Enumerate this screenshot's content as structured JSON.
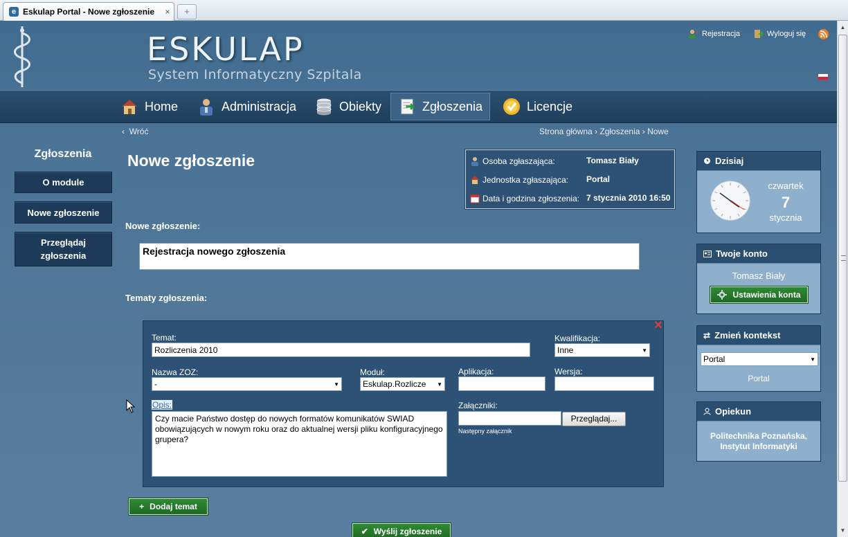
{
  "browser": {
    "tab_title": "Eskulap Portal - Nowe zgłoszenie",
    "tab_close": "×",
    "new_tab": "+"
  },
  "header": {
    "brand_title": "ESKULAP",
    "brand_subtitle": "System Informatyczny Szpitala",
    "register_link": "Rejestracja",
    "logout_link": "Wyloguj się"
  },
  "nav": {
    "items": [
      {
        "label": "Home",
        "icon": "house-icon"
      },
      {
        "label": "Administracja",
        "icon": "user-admin-icon"
      },
      {
        "label": "Obiekty",
        "icon": "database-icon"
      },
      {
        "label": "Zgłoszenia",
        "icon": "document-arrow-icon",
        "active": true
      },
      {
        "label": "Licencje",
        "icon": "certificate-badge-icon"
      }
    ]
  },
  "breadcrumb": {
    "back": "Wróć",
    "back_glyph": "‹",
    "path": "Strona główna › Zgłoszenia › Nowe"
  },
  "sidebar": {
    "title": "Zgłoszenia",
    "buttons": [
      "O module",
      "Nowe zgłoszenie",
      "Przeglądaj zgłoszenia"
    ]
  },
  "page": {
    "title": "Nowe zgłoszenie"
  },
  "info": {
    "reporter_label": "Osoba zgłaszająca:",
    "reporter_value": "Tomasz Biały",
    "unit_label": "Jednostka zgłaszająca:",
    "unit_value": "Portal",
    "datetime_label": "Data i godzina zgłoszenia:",
    "datetime_value": "7 stycznia 2010 16:50"
  },
  "form": {
    "new_ticket_label": "Nowe zgłoszenie:",
    "new_ticket_value": "Rejestracja nowego zgłoszenia",
    "topics_label": "Tematy zgłoszenia:",
    "topic_close": "✕",
    "topic": {
      "subject_label": "Temat:",
      "subject_value": "Rozliczenia 2010",
      "qualification_label": "Kwalifikacja:",
      "qualification_value": "Inne",
      "zoz_label": "Nazwa ZOZ:",
      "zoz_value": "-",
      "module_label": "Moduł:",
      "module_value": "Eskulap.Rozlicze",
      "application_label": "Aplikacja:",
      "application_value": "",
      "version_label": "Wersja:",
      "version_value": "",
      "description_label": "Opis:",
      "description_value": "Czy macie Państwo dostęp do nowych formatów komunikatów SWIAD obowiązujących w nowym roku oraz do aktualnej wersji pliku konfiguracyjnego grupera?",
      "attachments_label": "Załączniki:",
      "attachment_value": "",
      "browse_label": "Przeglądaj...",
      "next_attachment": "Następny załącznik"
    },
    "add_topic_label": "Dodaj temat",
    "add_topic_glyph": "+",
    "submit_label": "Wyślij zgłoszenie",
    "submit_glyph": "✔"
  },
  "widgets": {
    "today": {
      "title": "Dzisiaj",
      "weekday": "czwartek",
      "day": "7",
      "month": "stycznia"
    },
    "account": {
      "title": "Twoje konto",
      "user": "Tomasz Biały",
      "settings_label": "Ustawienia konta"
    },
    "context": {
      "title": "Zmień kontekst",
      "selected": "Portal",
      "current": "Portal"
    },
    "guardian": {
      "title": "Opiekun",
      "name": "Politechnika Poznańska, Instytut Informatyki"
    }
  },
  "colors": {
    "background": "#4a7396",
    "nav_bar": "#1f3f5c",
    "panel": "#2d5275",
    "button_green": "#2f8a33",
    "widget_body": "#8fb0cd"
  }
}
